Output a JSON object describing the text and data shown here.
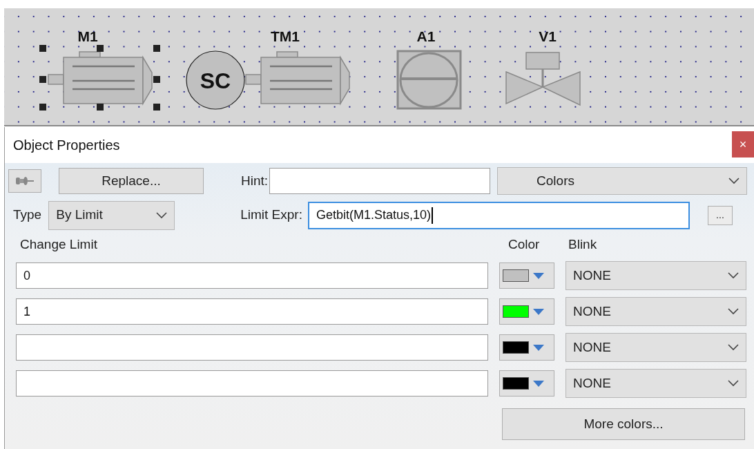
{
  "canvas": {
    "objects": [
      {
        "kind": "motor",
        "label": "M1",
        "selected": true
      },
      {
        "kind": "speed_controller",
        "text": "SC"
      },
      {
        "kind": "motor",
        "label": "TM1",
        "selected": false
      },
      {
        "kind": "analog",
        "label": "A1"
      },
      {
        "kind": "valve",
        "label": "V1"
      }
    ]
  },
  "dialog": {
    "title": "Object Properties",
    "close": "×",
    "replace_button": "Replace...",
    "hint_label": "Hint:",
    "section": "Colors",
    "type_label": "Type",
    "type_value": "By Limit",
    "limit_expr_label": "Limit Expr:",
    "limit_expr_value": "Getbit(M1.Status,10)",
    "browse_button": "...",
    "columns": [
      "Change Limit",
      "Color",
      "Blink"
    ],
    "rows": [
      {
        "limit": "0",
        "color": "#c0c0c0",
        "blink": "NONE"
      },
      {
        "limit": "1",
        "color": "#00ff00",
        "blink": "NONE"
      },
      {
        "color": "#000000",
        "blink": "NONE"
      },
      {
        "color": "#000000",
        "blink": "NONE"
      }
    ],
    "more_colors_button": "More colors..."
  }
}
